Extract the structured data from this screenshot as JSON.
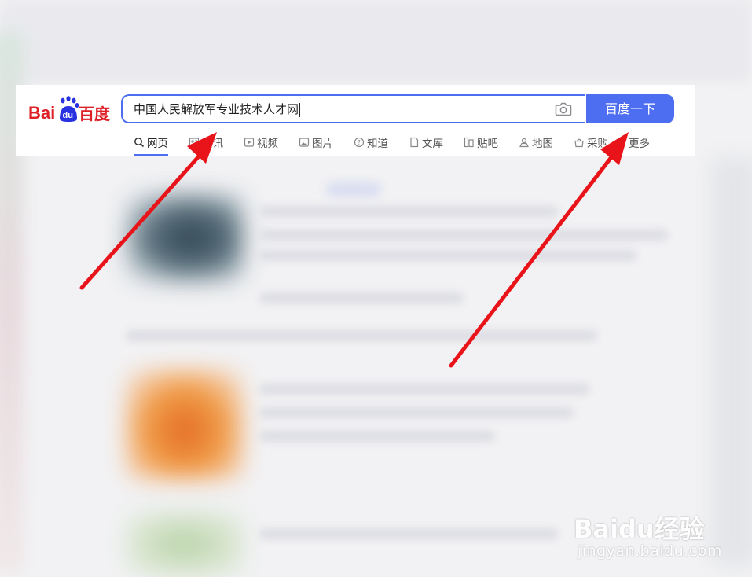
{
  "search": {
    "query": "中国人民解放军专业技术人才网",
    "button_label": "百度一下"
  },
  "logo": {
    "text_bai": "Bai",
    "text_du": "du",
    "text_cn": "百度"
  },
  "tabs": [
    {
      "label": "网页",
      "icon": "search-icon",
      "active": true
    },
    {
      "label": "资讯",
      "icon": "news-icon",
      "active": false
    },
    {
      "label": "视频",
      "icon": "video-icon",
      "active": false
    },
    {
      "label": "图片",
      "icon": "image-icon",
      "active": false
    },
    {
      "label": "知道",
      "icon": "question-icon",
      "active": false
    },
    {
      "label": "文库",
      "icon": "document-icon",
      "active": false
    },
    {
      "label": "贴吧",
      "icon": "tieba-icon",
      "active": false
    },
    {
      "label": "地图",
      "icon": "map-icon",
      "active": false
    },
    {
      "label": "采购",
      "icon": "basket-icon",
      "active": false
    },
    {
      "label": "更多",
      "icon": "",
      "active": false
    }
  ],
  "watermark": {
    "brand": "Baidu经验",
    "url": "jingyan.baidu.com"
  },
  "colors": {
    "accent": "#4e6ef2",
    "logo_red": "#de1f26",
    "logo_blue": "#2932e1",
    "arrow": "#e8141a"
  }
}
